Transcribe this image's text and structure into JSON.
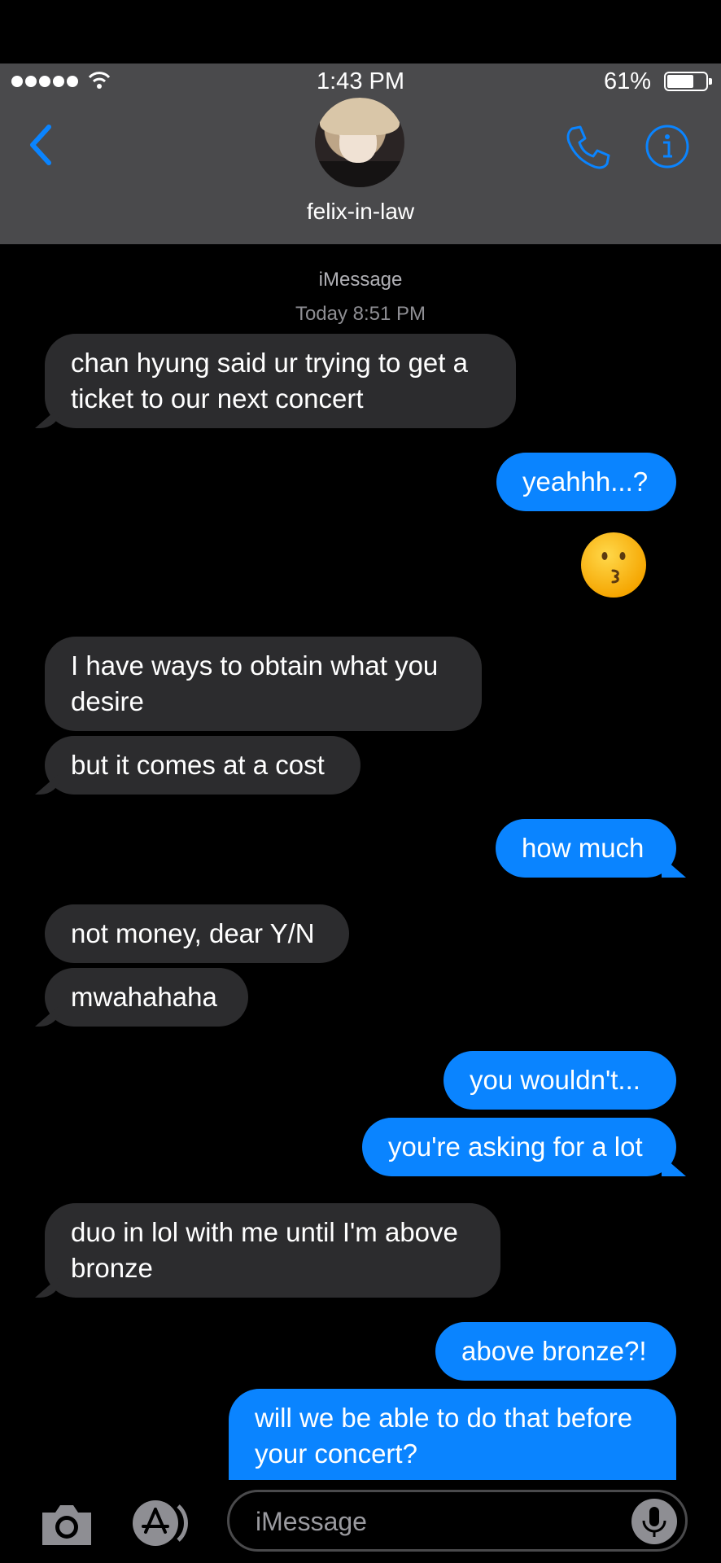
{
  "status": {
    "time": "1:43 PM",
    "battery": "61%"
  },
  "header": {
    "contact_name": "felix-in-law"
  },
  "thread": {
    "service": "iMessage",
    "timestamp": "Today 8:51 PM"
  },
  "messages": [
    {
      "from": "them",
      "text": [
        "chan hyung said ur trying to get a",
        "ticket to our next concert"
      ]
    },
    {
      "from": "me",
      "text": [
        "yeahhh...?"
      ]
    },
    {
      "from": "me",
      "emoji": "kissing-face"
    },
    {
      "from": "them",
      "text": [
        "I have ways to obtain what you",
        "desire"
      ]
    },
    {
      "from": "them",
      "text": [
        "but it comes at a cost"
      ]
    },
    {
      "from": "me",
      "text": [
        "how much"
      ]
    },
    {
      "from": "them",
      "text": [
        "not money, dear Y/N"
      ]
    },
    {
      "from": "them",
      "text": [
        "mwahahaha"
      ]
    },
    {
      "from": "me",
      "text": [
        "you wouldn't..."
      ]
    },
    {
      "from": "me",
      "text": [
        "you're asking for a lot"
      ]
    },
    {
      "from": "them",
      "text": [
        "duo in lol with me until I'm above",
        "bronze"
      ]
    },
    {
      "from": "me",
      "text": [
        "above bronze?!"
      ]
    },
    {
      "from": "me",
      "text": [
        "will we be able to do that before",
        "your concert?"
      ]
    }
  ],
  "input": {
    "placeholder": "iMessage"
  },
  "colors": {
    "outgoing": "#0a84ff",
    "incoming": "#2c2c2e",
    "header": "#4a4a4c",
    "accent": "#0a84ff"
  },
  "icons": [
    "back-chevron-icon",
    "phone-icon",
    "info-icon",
    "camera-icon",
    "app-store-icon",
    "mic-icon",
    "wifi-icon",
    "battery-icon"
  ]
}
